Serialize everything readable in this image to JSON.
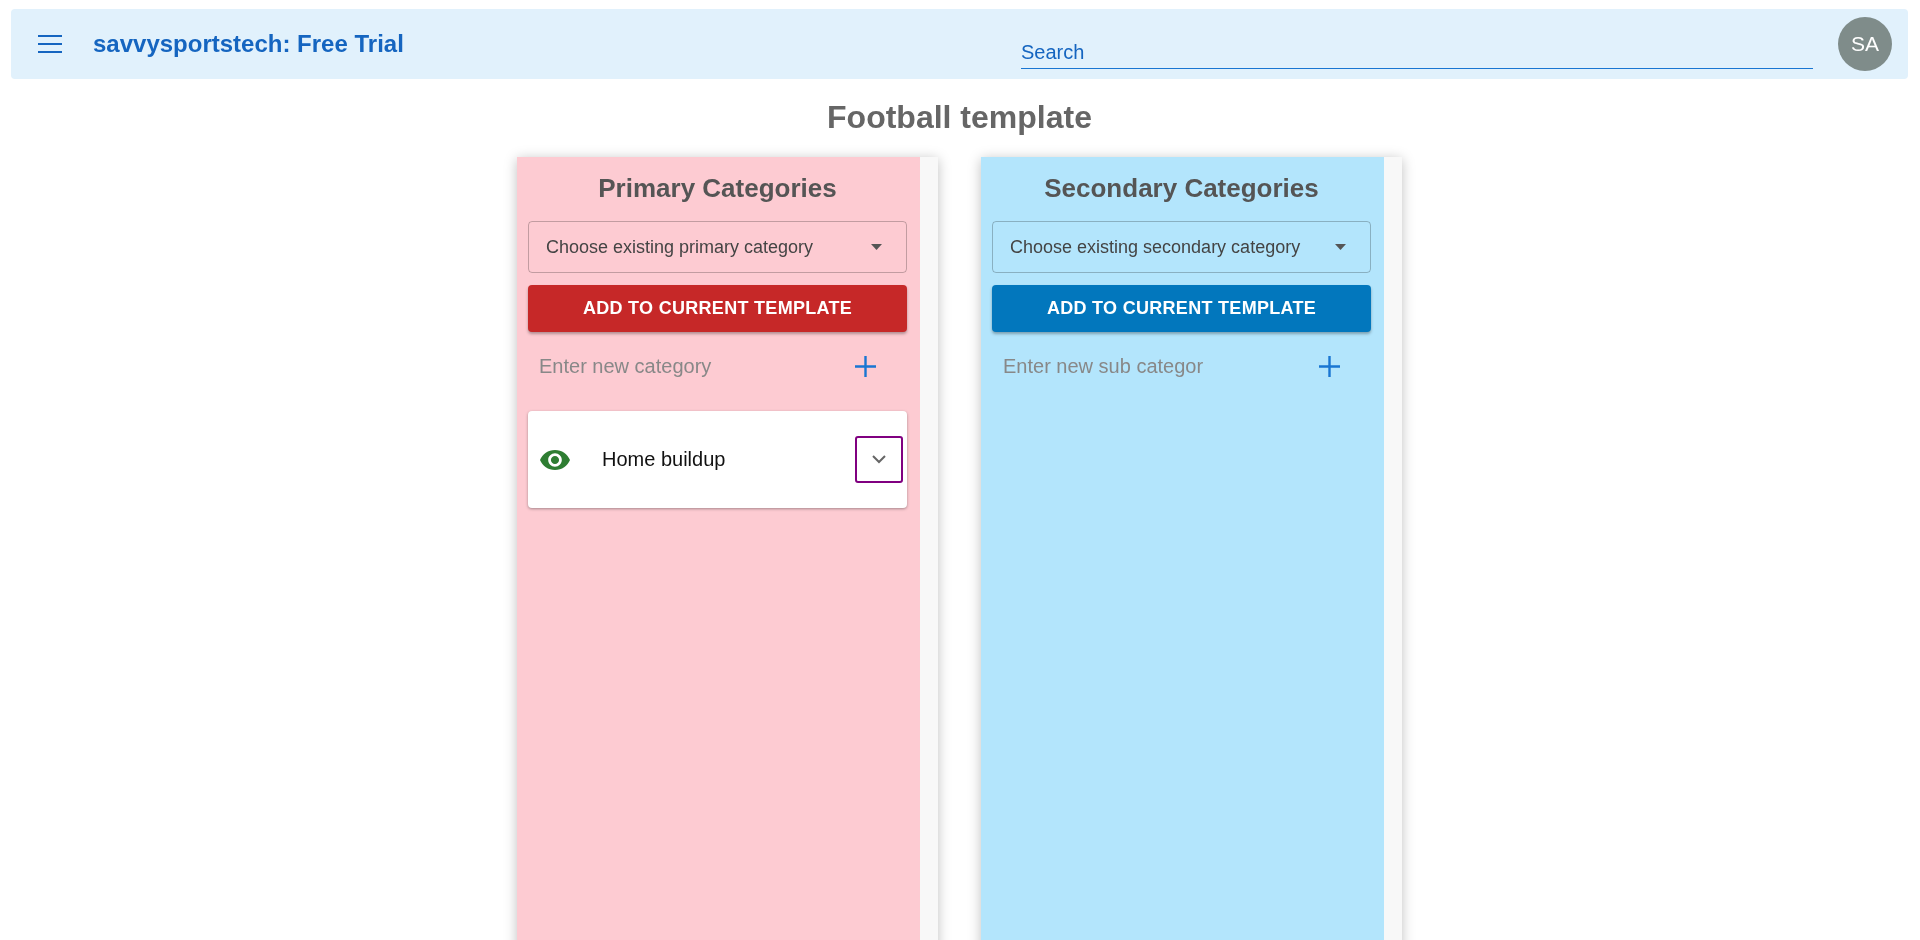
{
  "header": {
    "title": "savvysportstech: Free Trial",
    "search": {
      "placeholder": "Search"
    },
    "avatar": {
      "initials": "SA"
    }
  },
  "page_title": "Football template",
  "panels": [
    {
      "kind": "primary",
      "title": "Primary Categories",
      "select": {
        "placeholder": "Choose existing primary category"
      },
      "add_button": "ADD TO CURRENT TEMPLATE",
      "new_input": {
        "placeholder": "Enter new category"
      },
      "items": [
        {
          "label": "Home buildup",
          "focused": true
        }
      ]
    },
    {
      "kind": "secondary",
      "title": "Secondary Categories",
      "select": {
        "placeholder": "Choose existing secondary category"
      },
      "add_button": "ADD TO CURRENT TEMPLATE",
      "new_input": {
        "placeholder": "Enter new sub categor"
      }
    }
  ]
}
